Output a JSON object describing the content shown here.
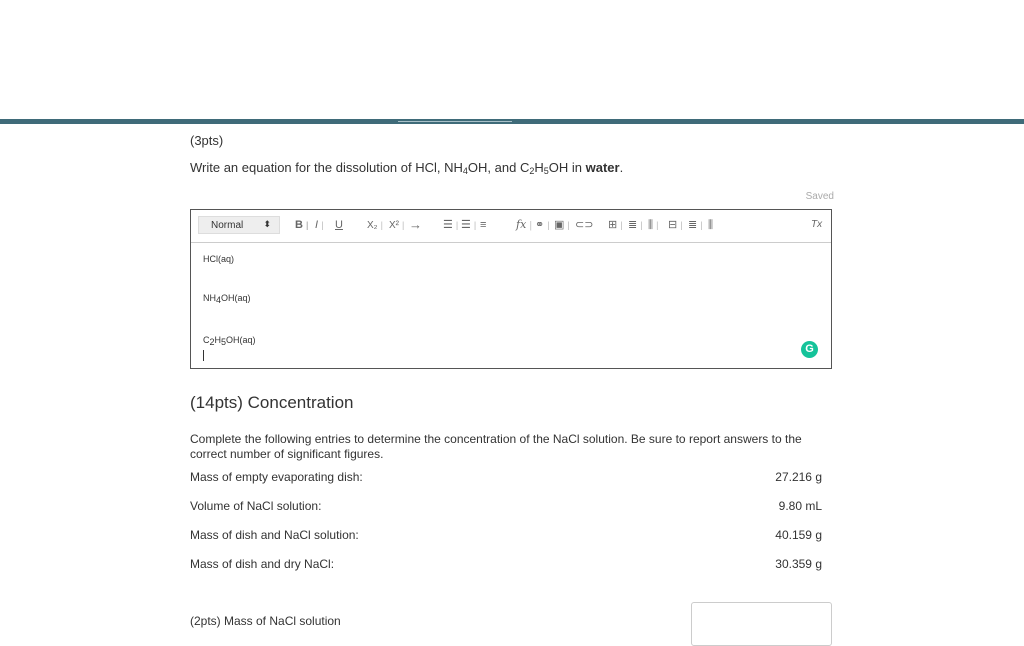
{
  "question1": {
    "points": "(3pts)",
    "prompt_prefix": "Write an equation for the dissolution of HCl, NH",
    "prompt_sub1": "4",
    "prompt_mid1": "OH, and C",
    "prompt_sub2": "2",
    "prompt_mid2": "H",
    "prompt_sub3": "5",
    "prompt_mid3": "OH in ",
    "prompt_bold": "water",
    "prompt_end": "."
  },
  "editor": {
    "saved_status": "Saved",
    "format_select": "Normal",
    "lines": [
      {
        "text": "HCl(aq)"
      },
      {
        "pre": "NH",
        "sub": "4",
        "post": "OH(aq)"
      },
      {
        "pre": "C",
        "sub": "2",
        "mid": "H",
        "sub2": "5",
        "post": "OH(aq)"
      }
    ],
    "grammarly_letter": "G"
  },
  "toolbar_glyphs": {
    "bold": "B",
    "italic": "I",
    "underline": "U",
    "subscript": "X₂",
    "superscript": "X²",
    "arrow": "→",
    "formula": "fx",
    "clear": "Tx"
  },
  "section2": {
    "heading": "(14pts) Concentration",
    "instructions": "Complete the following entries to determine the concentration of the NaCl solution. Be sure to report answers to the correct number of significant figures.",
    "rows": [
      {
        "label": "Mass of empty evaporating dish:",
        "value": "27.216 g"
      },
      {
        "label": "Volume of NaCl solution:",
        "value": "9.80 mL"
      },
      {
        "label": "Mass of dish and NaCl solution:",
        "value": "40.159 g"
      },
      {
        "label": "Mass of dish and dry NaCl:",
        "value": "30.359 g"
      }
    ],
    "subquestion": "(2pts)  Mass of NaCl solution"
  },
  "colors": {
    "topbar": "#3f6b79",
    "grammarly": "#15c39a"
  }
}
